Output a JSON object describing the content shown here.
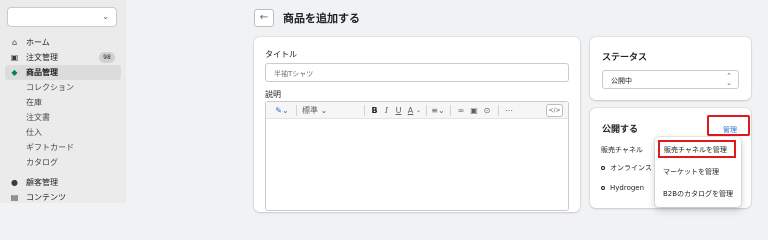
{
  "sidebar": {
    "store_select_value": "",
    "items": [
      {
        "label": "ホーム",
        "icon": "home-icon",
        "glyph": "⌂"
      },
      {
        "label": "注文管理",
        "icon": "orders-icon",
        "glyph": "▣",
        "badge": "98"
      },
      {
        "label": "商品管理",
        "icon": "tag-icon",
        "glyph": "◆"
      },
      {
        "label": "コレクション"
      },
      {
        "label": "在庫"
      },
      {
        "label": "注文書"
      },
      {
        "label": "仕入"
      },
      {
        "label": "ギフトカード"
      },
      {
        "label": "カタログ"
      },
      {
        "label": "顧客管理",
        "icon": "customer-icon",
        "glyph": "●"
      },
      {
        "label": "コンテンツ",
        "icon": "content-icon",
        "glyph": "▤"
      }
    ]
  },
  "header": {
    "back_glyph": "←",
    "title": "商品を追加する"
  },
  "product_form": {
    "title_label": "タイトル",
    "title_placeholder": "半袖Tシャツ",
    "description_label": "説明",
    "toolbar": {
      "format_value": "標準",
      "bold": "B",
      "italic": "I",
      "underline": "U",
      "color": "A",
      "code": "</>"
    }
  },
  "status": {
    "title": "ステータス",
    "value": "公開中"
  },
  "publishing": {
    "title": "公開する",
    "manage_label": "管理",
    "sales_channels_label": "販売チャネル",
    "channels": [
      "オンラインス",
      "Hydrogen"
    ],
    "menu": [
      "販売チャネルを管理",
      "マーケットを管理",
      "B2Bのカタログを管理"
    ]
  },
  "colors": {
    "accent_green": "#008060",
    "highlight_red": "#e0191c",
    "link_blue": "#2c6ecb"
  }
}
